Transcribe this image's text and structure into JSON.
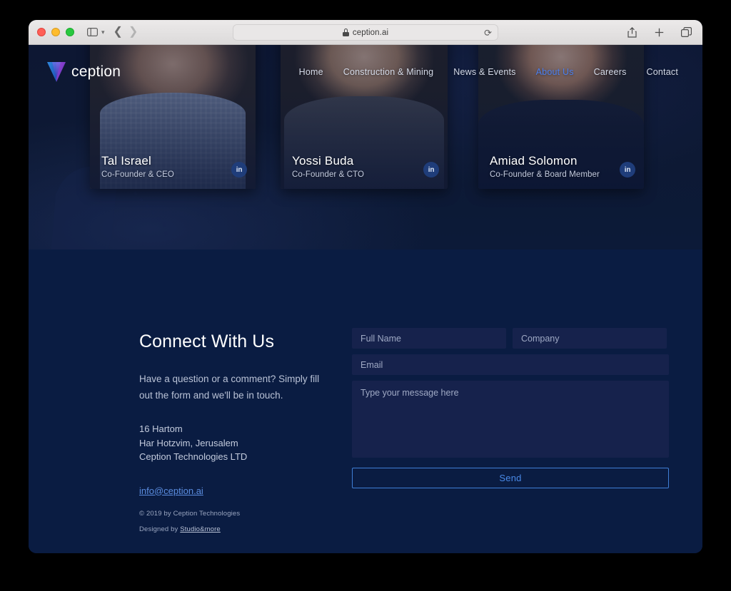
{
  "browser": {
    "url": "ception.ai",
    "lock_icon": "lock-icon",
    "reload_icon": "reload-icon",
    "sidebar_icon": "sidebar-toggle-icon",
    "chevron_icon": "chevron-down-icon",
    "back_icon": "back-arrow-icon",
    "forward_icon": "forward-arrow-icon",
    "share_icon": "share-icon",
    "newtab_icon": "plus-icon",
    "tabs_icon": "tab-overview-icon"
  },
  "site": {
    "brand": "ception",
    "brand_logo_icon": "ception-v-logo-icon",
    "nav": [
      {
        "label": "Home",
        "active": false
      },
      {
        "label": "Construction & Mining",
        "active": false
      },
      {
        "label": "News & Events",
        "active": false
      },
      {
        "label": "About Us",
        "active": true
      },
      {
        "label": "Careers",
        "active": false
      },
      {
        "label": "Contact",
        "active": false
      }
    ]
  },
  "team": [
    {
      "name": "Tal Israel",
      "role": "Co-Founder & CEO",
      "social": "in",
      "social_icon": "linkedin-icon"
    },
    {
      "name": "Yossi Buda",
      "role": "Co-Founder & CTO",
      "social": "in",
      "social_icon": "linkedin-icon"
    },
    {
      "name": "Amiad Solomon",
      "role": "Co-Founder & Board Member",
      "social": "in",
      "social_icon": "linkedin-icon"
    }
  ],
  "contact": {
    "title": "Connect With Us",
    "blurb": "Have a question or a comment? Simply fill out the form and we'll be in touch.",
    "address": {
      "line1": "16 Hartom",
      "line2": "Har Hotzvim, Jerusalem",
      "line3": "Ception Technologies LTD"
    },
    "email": "info@ception.ai",
    "copyright": "© 2019 by Ception Technologies",
    "designed_prefix": "Designed by ",
    "designed_by": "Studio&more"
  },
  "form": {
    "full_name_placeholder": "Full Name",
    "company_placeholder": "Company",
    "email_placeholder": "Email",
    "message_placeholder": "Type your message here",
    "send_label": "Send"
  },
  "colors": {
    "page_bg": "#0a1c42",
    "hero_bg": "#0d1733",
    "field_bg": "#16224c",
    "accent": "#4a8ae8",
    "nav_active": "#4a7ff0",
    "link": "#5b8de0"
  }
}
